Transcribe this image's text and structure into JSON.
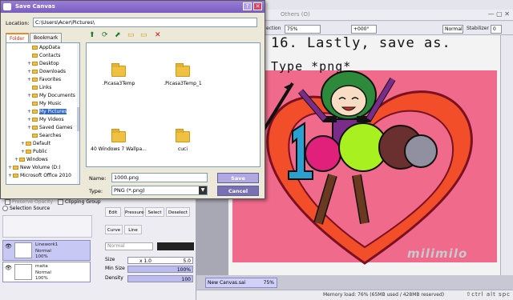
{
  "app": {
    "menu": [
      "Others (O)"
    ],
    "toolbar": {
      "zoom": "75%",
      "rotation": "+000°",
      "blend": "Normal",
      "stabilizer_label": "Stabilizer",
      "stabilizer_value": "0",
      "selection_label": "ection"
    },
    "tutorial_text": {
      "line1": "16. Lastly, save as.",
      "line2": "Type *png*"
    },
    "watermark": "milimilo",
    "document_tab": {
      "name": "New Canvas.sai",
      "zoom": "75%"
    },
    "status": {
      "memory": "Memory load: 76% (65MB used / 428MB reserved)",
      "icons": "⇧ctrl alt spc"
    }
  },
  "left_panel": {
    "clipping_group": "Clipping Group",
    "preserve_opacity": "Preserve Opacity",
    "selection_source": "Selection Source",
    "layers": [
      {
        "name": "Linework1",
        "mode": "Normal",
        "opacity": "100%",
        "selected": true
      },
      {
        "name": "maita",
        "mode": "Normal",
        "opacity": "100%",
        "selected": false
      }
    ],
    "tools": [
      "Edit",
      "Pressure",
      "Select",
      "Deselect",
      "Curve",
      "Line"
    ],
    "brush_mode": "Normal",
    "size_label": "Size",
    "size_mult": "x 1.0",
    "size_value": "5.0",
    "min_size_label": "Min Size",
    "min_size_value": "100%",
    "min_size_level": 1.0,
    "density_label": "Density",
    "density_value": "100",
    "density_level": 1.0
  },
  "dialog": {
    "title": "Save Canvas",
    "location_label": "Location:",
    "location_value": "C:\\Users\\Acer\\Pictures\\",
    "tabs": [
      "Folder",
      "Bookmark"
    ],
    "tree": [
      {
        "label": "AppData",
        "indent": 3,
        "plus": ""
      },
      {
        "label": "Contacts",
        "indent": 3,
        "plus": ""
      },
      {
        "label": "Desktop",
        "indent": 3,
        "plus": "+"
      },
      {
        "label": "Downloads",
        "indent": 3,
        "plus": "+"
      },
      {
        "label": "Favorites",
        "indent": 3,
        "plus": "+"
      },
      {
        "label": "Links",
        "indent": 3,
        "plus": ""
      },
      {
        "label": "My Documents",
        "indent": 3,
        "plus": "+"
      },
      {
        "label": "My Music",
        "indent": 3,
        "plus": ""
      },
      {
        "label": "My Pictures",
        "indent": 3,
        "plus": "+",
        "selected": true
      },
      {
        "label": "My Videos",
        "indent": 3,
        "plus": "+"
      },
      {
        "label": "Saved Games",
        "indent": 3,
        "plus": "+"
      },
      {
        "label": "Searches",
        "indent": 3,
        "plus": ""
      },
      {
        "label": "Default",
        "indent": 2,
        "plus": "+"
      },
      {
        "label": "Public",
        "indent": 2,
        "plus": "+"
      },
      {
        "label": "Windows",
        "indent": 1,
        "plus": "+"
      },
      {
        "label": "New Volume (D:)",
        "indent": 0,
        "plus": "+"
      },
      {
        "label": "Microsoft Office 2010",
        "indent": 0,
        "plus": "+"
      }
    ],
    "files": [
      ".Picasa3Temp",
      ".Picasa3Temp_1",
      "40 Windows 7 Wallpa...",
      "cuci"
    ],
    "name_label": "Name:",
    "name_value": "1000.png",
    "type_label": "Type:",
    "type_value": "PNG (*.png)",
    "save_label": "Save",
    "cancel_label": "Cancel"
  }
}
